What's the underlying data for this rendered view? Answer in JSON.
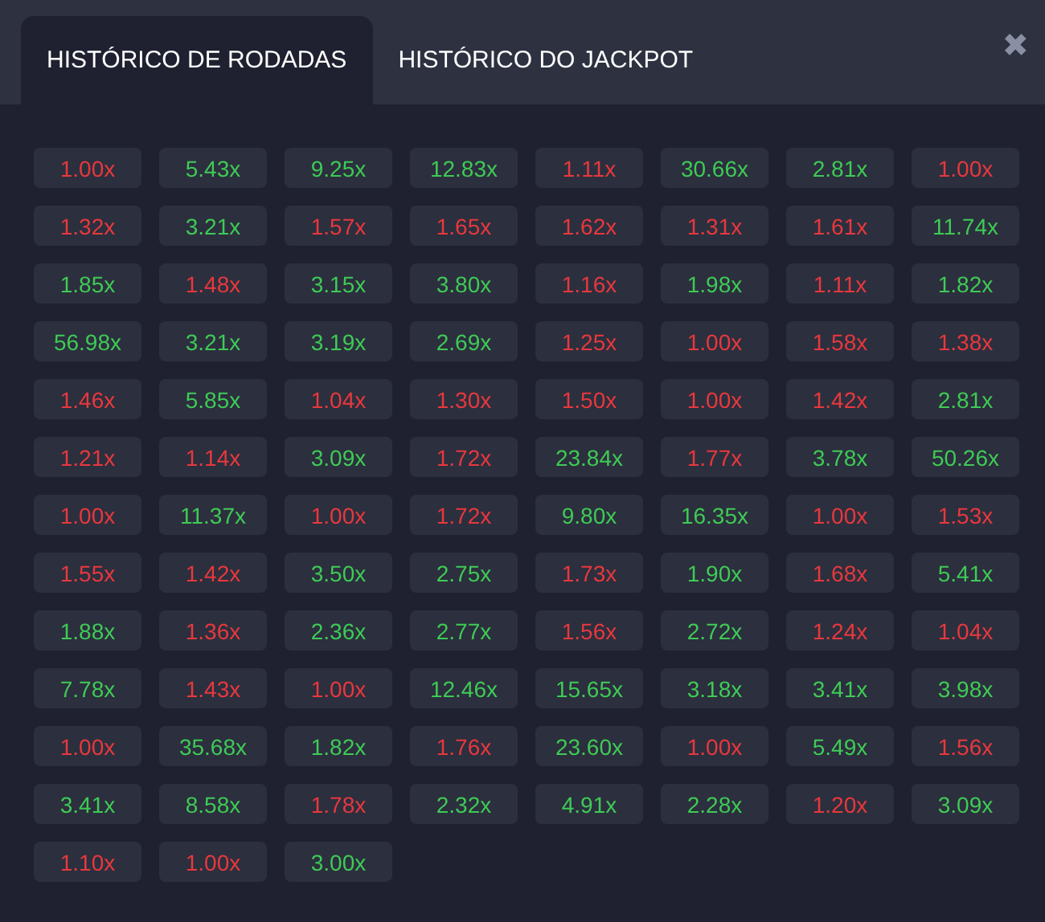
{
  "tabs": [
    {
      "label": "HISTÓRICO DE RODADAS",
      "selected": true
    },
    {
      "label": "HISTÓRICO DO JACKPOT",
      "selected": false
    }
  ],
  "close": {
    "label": "✖"
  },
  "results": [
    {
      "value": "1.00x",
      "color": "#e8383d"
    },
    {
      "value": "5.43x",
      "color": "#3ecb55"
    },
    {
      "value": "9.25x",
      "color": "#3ecb55"
    },
    {
      "value": "12.83x",
      "color": "#3ecb55"
    },
    {
      "value": "1.11x",
      "color": "#e8383d"
    },
    {
      "value": "30.66x",
      "color": "#3ecb55"
    },
    {
      "value": "2.81x",
      "color": "#3ecb55"
    },
    {
      "value": "1.00x",
      "color": "#e8383d"
    },
    {
      "value": "1.32x",
      "color": "#e8383d"
    },
    {
      "value": "3.21x",
      "color": "#3ecb55"
    },
    {
      "value": "1.57x",
      "color": "#e8383d"
    },
    {
      "value": "1.65x",
      "color": "#e8383d"
    },
    {
      "value": "1.62x",
      "color": "#e8383d"
    },
    {
      "value": "1.31x",
      "color": "#e8383d"
    },
    {
      "value": "1.61x",
      "color": "#e8383d"
    },
    {
      "value": "11.74x",
      "color": "#3ecb55"
    },
    {
      "value": "1.85x",
      "color": "#3ecb55"
    },
    {
      "value": "1.48x",
      "color": "#e8383d"
    },
    {
      "value": "3.15x",
      "color": "#3ecb55"
    },
    {
      "value": "3.80x",
      "color": "#3ecb55"
    },
    {
      "value": "1.16x",
      "color": "#e8383d"
    },
    {
      "value": "1.98x",
      "color": "#3ecb55"
    },
    {
      "value": "1.11x",
      "color": "#e8383d"
    },
    {
      "value": "1.82x",
      "color": "#3ecb55"
    },
    {
      "value": "56.98x",
      "color": "#3ecb55"
    },
    {
      "value": "3.21x",
      "color": "#3ecb55"
    },
    {
      "value": "3.19x",
      "color": "#3ecb55"
    },
    {
      "value": "2.69x",
      "color": "#3ecb55"
    },
    {
      "value": "1.25x",
      "color": "#e8383d"
    },
    {
      "value": "1.00x",
      "color": "#e8383d"
    },
    {
      "value": "1.58x",
      "color": "#e8383d"
    },
    {
      "value": "1.38x",
      "color": "#e8383d"
    },
    {
      "value": "1.46x",
      "color": "#e8383d"
    },
    {
      "value": "5.85x",
      "color": "#3ecb55"
    },
    {
      "value": "1.04x",
      "color": "#e8383d"
    },
    {
      "value": "1.30x",
      "color": "#e8383d"
    },
    {
      "value": "1.50x",
      "color": "#e8383d"
    },
    {
      "value": "1.00x",
      "color": "#e8383d"
    },
    {
      "value": "1.42x",
      "color": "#e8383d"
    },
    {
      "value": "2.81x",
      "color": "#3ecb55"
    },
    {
      "value": "1.21x",
      "color": "#e8383d"
    },
    {
      "value": "1.14x",
      "color": "#e8383d"
    },
    {
      "value": "3.09x",
      "color": "#3ecb55"
    },
    {
      "value": "1.72x",
      "color": "#e8383d"
    },
    {
      "value": "23.84x",
      "color": "#3ecb55"
    },
    {
      "value": "1.77x",
      "color": "#e8383d"
    },
    {
      "value": "3.78x",
      "color": "#3ecb55"
    },
    {
      "value": "50.26x",
      "color": "#3ecb55"
    },
    {
      "value": "1.00x",
      "color": "#e8383d"
    },
    {
      "value": "11.37x",
      "color": "#3ecb55"
    },
    {
      "value": "1.00x",
      "color": "#e8383d"
    },
    {
      "value": "1.72x",
      "color": "#e8383d"
    },
    {
      "value": "9.80x",
      "color": "#3ecb55"
    },
    {
      "value": "16.35x",
      "color": "#3ecb55"
    },
    {
      "value": "1.00x",
      "color": "#e8383d"
    },
    {
      "value": "1.53x",
      "color": "#e8383d"
    },
    {
      "value": "1.55x",
      "color": "#e8383d"
    },
    {
      "value": "1.42x",
      "color": "#e8383d"
    },
    {
      "value": "3.50x",
      "color": "#3ecb55"
    },
    {
      "value": "2.75x",
      "color": "#3ecb55"
    },
    {
      "value": "1.73x",
      "color": "#e8383d"
    },
    {
      "value": "1.90x",
      "color": "#3ecb55"
    },
    {
      "value": "1.68x",
      "color": "#e8383d"
    },
    {
      "value": "5.41x",
      "color": "#3ecb55"
    },
    {
      "value": "1.88x",
      "color": "#3ecb55"
    },
    {
      "value": "1.36x",
      "color": "#e8383d"
    },
    {
      "value": "2.36x",
      "color": "#3ecb55"
    },
    {
      "value": "2.77x",
      "color": "#3ecb55"
    },
    {
      "value": "1.56x",
      "color": "#e8383d"
    },
    {
      "value": "2.72x",
      "color": "#3ecb55"
    },
    {
      "value": "1.24x",
      "color": "#e8383d"
    },
    {
      "value": "1.04x",
      "color": "#e8383d"
    },
    {
      "value": "7.78x",
      "color": "#3ecb55"
    },
    {
      "value": "1.43x",
      "color": "#e8383d"
    },
    {
      "value": "1.00x",
      "color": "#e8383d"
    },
    {
      "value": "12.46x",
      "color": "#3ecb55"
    },
    {
      "value": "15.65x",
      "color": "#3ecb55"
    },
    {
      "value": "3.18x",
      "color": "#3ecb55"
    },
    {
      "value": "3.41x",
      "color": "#3ecb55"
    },
    {
      "value": "3.98x",
      "color": "#3ecb55"
    },
    {
      "value": "1.00x",
      "color": "#e8383d"
    },
    {
      "value": "35.68x",
      "color": "#3ecb55"
    },
    {
      "value": "1.82x",
      "color": "#3ecb55"
    },
    {
      "value": "1.76x",
      "color": "#e8383d"
    },
    {
      "value": "23.60x",
      "color": "#3ecb55"
    },
    {
      "value": "1.00x",
      "color": "#e8383d"
    },
    {
      "value": "5.49x",
      "color": "#3ecb55"
    },
    {
      "value": "1.56x",
      "color": "#e8383d"
    },
    {
      "value": "3.41x",
      "color": "#3ecb55"
    },
    {
      "value": "8.58x",
      "color": "#3ecb55"
    },
    {
      "value": "1.78x",
      "color": "#e8383d"
    },
    {
      "value": "2.32x",
      "color": "#3ecb55"
    },
    {
      "value": "4.91x",
      "color": "#3ecb55"
    },
    {
      "value": "2.28x",
      "color": "#3ecb55"
    },
    {
      "value": "1.20x",
      "color": "#e8383d"
    },
    {
      "value": "3.09x",
      "color": "#3ecb55"
    },
    {
      "value": "1.10x",
      "color": "#e8383d"
    },
    {
      "value": "1.00x",
      "color": "#e8383d"
    },
    {
      "value": "3.00x",
      "color": "#3ecb55"
    }
  ]
}
